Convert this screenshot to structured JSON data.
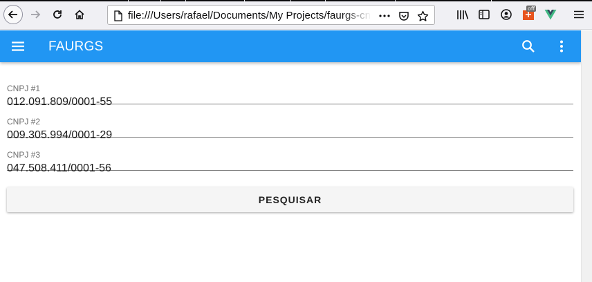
{
  "browser": {
    "url": "file:///Users/rafael/Documents/My Projects/faurgs-cnpj-",
    "extension_badge": "off"
  },
  "app_bar": {
    "title": "FAURGS",
    "color": "#2196f3"
  },
  "form": {
    "fields": [
      {
        "label": "CNPJ #1",
        "value": "012.091.809/0001-55"
      },
      {
        "label": "CNPJ #2",
        "value": "009.305.994/0001-29"
      },
      {
        "label": "CNPJ #3",
        "value": "047.508.411/0001-56"
      }
    ],
    "search_button": "PESQUISAR"
  },
  "icons": {
    "back": "arrow-left-icon",
    "forward": "arrow-right-icon",
    "reload": "reload-icon",
    "home": "home-icon",
    "page": "page-icon",
    "page_actions": "more-horizontal-icon",
    "pocket": "pocket-icon",
    "bookmark": "star-icon",
    "library": "library-icon",
    "sidebar": "sidebar-icon",
    "account": "account-icon",
    "extension": "extension-icon",
    "vue_devtools": "vue-icon",
    "browser_menu": "hamburger-icon",
    "app_menu": "menu-icon",
    "app_search": "search-icon",
    "app_more": "more-vertical-icon"
  }
}
